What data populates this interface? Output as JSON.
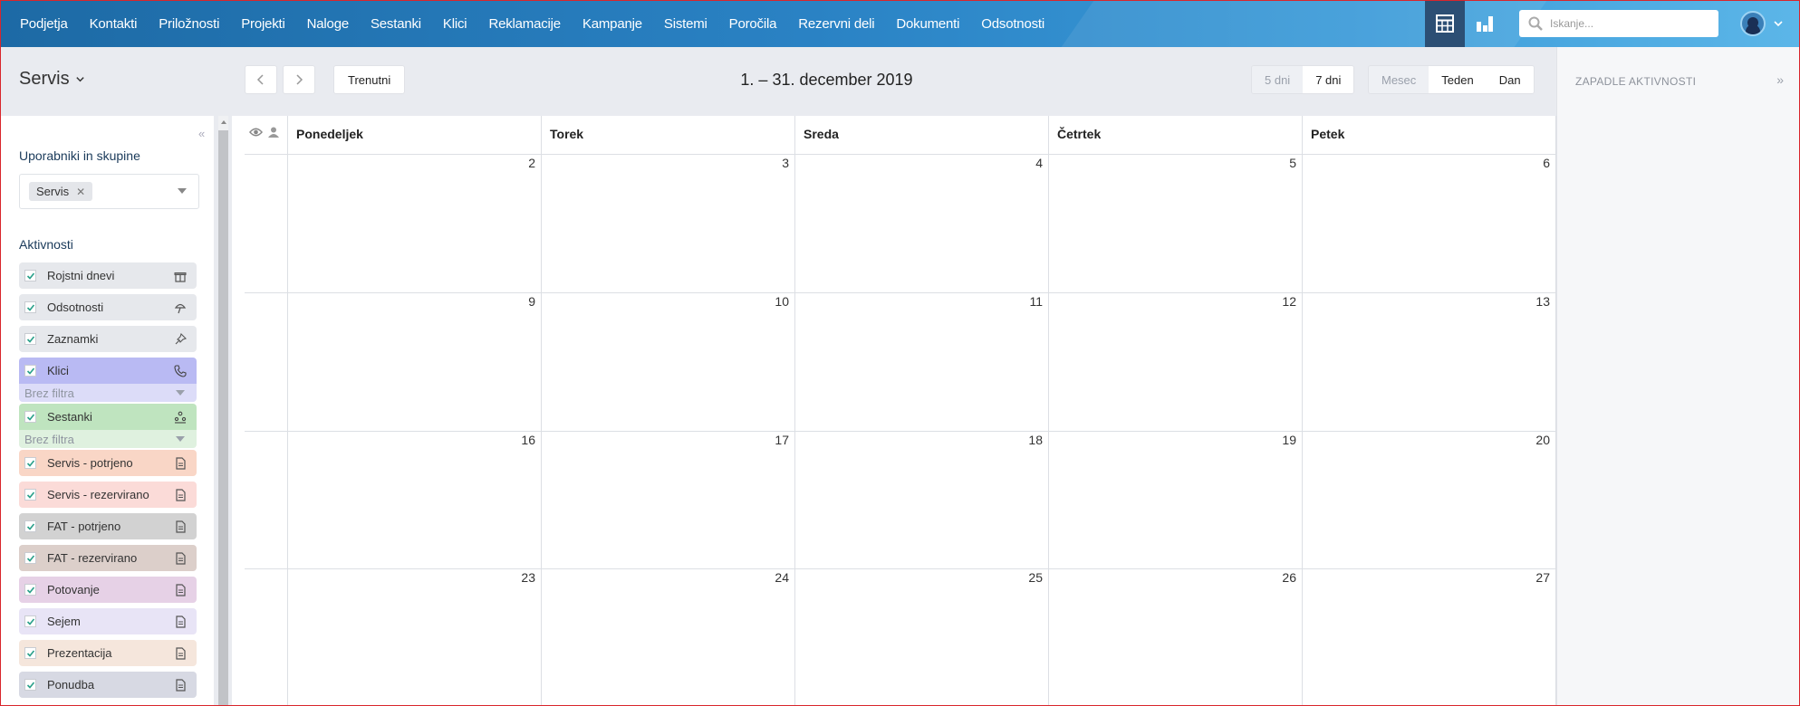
{
  "nav": {
    "items": [
      "Podjetja",
      "Kontakti",
      "Priložnosti",
      "Projekti",
      "Naloge",
      "Sestanki",
      "Klici",
      "Reklamacije",
      "Kampanje",
      "Sistemi",
      "Poročila",
      "Rezervni deli",
      "Dokumenti",
      "Odsotnosti"
    ],
    "search_placeholder": "Iskanje..."
  },
  "header": {
    "team": "Servis",
    "today": "Trenutni",
    "range": "1. – 31. december 2019",
    "days_options": [
      "5 dni",
      "7 dni"
    ],
    "view_options": [
      "Mesec",
      "Teden",
      "Dan"
    ]
  },
  "sidebar": {
    "users_title": "Uporabniki in skupine",
    "selected_chip": "Servis",
    "activities_title": "Aktivnosti",
    "activities": [
      {
        "label": "Rojstni dnevi",
        "icon": "gift-icon",
        "color": "#e6e8ec"
      },
      {
        "label": "Odsotnosti",
        "icon": "umbrella-icon",
        "color": "#e6e8ec"
      },
      {
        "label": "Zaznamki",
        "icon": "pin-icon",
        "color": "#e6e8ec"
      },
      {
        "label": "Klici",
        "icon": "phone-icon",
        "color": "#b9baf3",
        "filter": "Brez filtra",
        "filter_color": "#dcdcf8"
      },
      {
        "label": "Sestanki",
        "icon": "meeting-icon",
        "color": "#bfe4bf",
        "filter": "Brez filtra",
        "filter_color": "#dff1df"
      },
      {
        "label": "Servis - potrjeno",
        "icon": "document-icon",
        "color": "#f9d6c6"
      },
      {
        "label": "Servis - rezervirano",
        "icon": "document-icon",
        "color": "#fbdbd8"
      },
      {
        "label": "FAT - potrjeno",
        "icon": "document-icon",
        "color": "#d2d2d2"
      },
      {
        "label": "FAT - rezervirano",
        "icon": "document-icon",
        "color": "#dccfca"
      },
      {
        "label": "Potovanje",
        "icon": "document-icon",
        "color": "#e6d1e6"
      },
      {
        "label": "Sejem",
        "icon": "document-icon",
        "color": "#e8e4f6"
      },
      {
        "label": "Prezentacija",
        "icon": "document-icon",
        "color": "#f5e6dc"
      },
      {
        "label": "Ponudba",
        "icon": "document-icon",
        "color": "#d7d9e3"
      }
    ]
  },
  "calendar": {
    "day_names": [
      "Ponedeljek",
      "Torek",
      "Sreda",
      "Četrtek",
      "Petek"
    ],
    "weeks": [
      [
        "2",
        "3",
        "4",
        "5",
        "6"
      ],
      [
        "9",
        "10",
        "11",
        "12",
        "13"
      ],
      [
        "16",
        "17",
        "18",
        "19",
        "20"
      ],
      [
        "23",
        "24",
        "25",
        "26",
        "27"
      ]
    ]
  },
  "right_panel": {
    "title": "ZAPADLE AKTIVNOSTI"
  }
}
